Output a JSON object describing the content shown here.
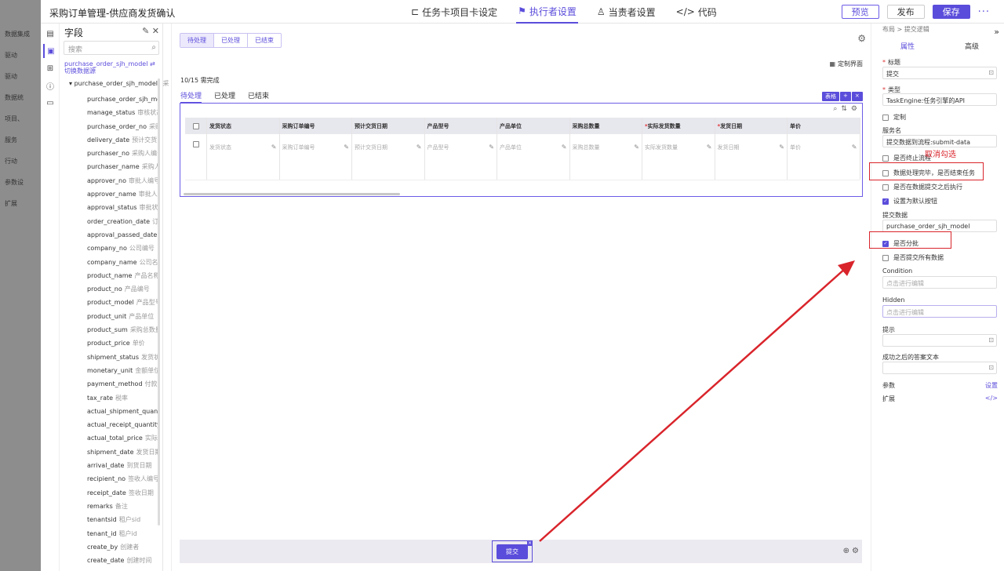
{
  "background": {
    "items": [
      "数据集成",
      "驱动",
      "驱动",
      "数据统",
      "项目、",
      "服务",
      "行动",
      "参数设",
      "扩展"
    ]
  },
  "header": {
    "title": "采购订单管理-供应商发货确认",
    "tabs": [
      {
        "label": "任务卡项目卡设定",
        "icon": "link-icon"
      },
      {
        "label": "执行者设置",
        "icon": "runner-icon"
      },
      {
        "label": "当责者设置",
        "icon": "person-icon"
      },
      {
        "label": "代码",
        "icon": "code-icon"
      }
    ],
    "preview_label": "预览",
    "publish_label": "发布",
    "save_label": "保存"
  },
  "fields_panel": {
    "title": "字段",
    "search_placeholder": "搜索",
    "datasource": "purchase_order_sjh_model",
    "switch_label": "切换数据源",
    "root": "purchase_order_sjh_model",
    "root_suffix": "采",
    "items": [
      {
        "name": "purchase_order_sjh_model",
        "cn": ""
      },
      {
        "name": "manage_status",
        "cn": "审核状态"
      },
      {
        "name": "purchase_order_no",
        "cn": "采购订"
      },
      {
        "name": "delivery_date",
        "cn": "预计交货日"
      },
      {
        "name": "purchaser_no",
        "cn": "采购人编号"
      },
      {
        "name": "purchaser_name",
        "cn": "采购人名"
      },
      {
        "name": "approver_no",
        "cn": "审批人编号"
      },
      {
        "name": "approver_name",
        "cn": "审批人名"
      },
      {
        "name": "approval_status",
        "cn": "审批状态"
      },
      {
        "name": "order_creation_date",
        "cn": "订单"
      },
      {
        "name": "approval_passed_date",
        "cn": "审"
      },
      {
        "name": "company_no",
        "cn": "公司编号"
      },
      {
        "name": "company_name",
        "cn": "公司名称"
      },
      {
        "name": "product_name",
        "cn": "产品名称"
      },
      {
        "name": "product_no",
        "cn": "产品编号"
      },
      {
        "name": "product_model",
        "cn": "产品型号"
      },
      {
        "name": "product_unit",
        "cn": "产品单位"
      },
      {
        "name": "product_sum",
        "cn": "采购总数量"
      },
      {
        "name": "product_price",
        "cn": "单价"
      },
      {
        "name": "shipment_status",
        "cn": "发货状态"
      },
      {
        "name": "monetary_unit",
        "cn": "金额单位"
      },
      {
        "name": "payment_method",
        "cn": "付款方"
      },
      {
        "name": "tax_rate",
        "cn": "税率"
      },
      {
        "name": "actual_shipment_quantity",
        "cn": ""
      },
      {
        "name": "actual_receipt_quantity",
        "cn": "实"
      },
      {
        "name": "actual_total_price",
        "cn": "实际总"
      },
      {
        "name": "shipment_date",
        "cn": "发货日期"
      },
      {
        "name": "arrival_date",
        "cn": "到货日期"
      },
      {
        "name": "recipient_no",
        "cn": "签收人编号"
      },
      {
        "name": "receipt_date",
        "cn": "签收日期"
      },
      {
        "name": "remarks",
        "cn": "备注"
      },
      {
        "name": "tenantsid",
        "cn": "租户sid"
      },
      {
        "name": "tenant_id",
        "cn": "租户id"
      },
      {
        "name": "create_by",
        "cn": "创建者"
      },
      {
        "name": "create_date",
        "cn": "创建时间"
      }
    ]
  },
  "canvas": {
    "segments": [
      "待处理",
      "已处理",
      "已结束"
    ],
    "customize_label": "定制界面",
    "progress": "10/15 需完成",
    "tabs": [
      "待处理",
      "已处理",
      "已结束"
    ],
    "table_badge": "表格",
    "columns": [
      {
        "label": "发货状态",
        "required": false,
        "placeholder": "发货状态"
      },
      {
        "label": "采购订单编号",
        "required": false,
        "placeholder": "采购订单编号"
      },
      {
        "label": "预计交货日期",
        "required": false,
        "placeholder": "预计交货日期"
      },
      {
        "label": "产品型号",
        "required": false,
        "placeholder": "产品型号"
      },
      {
        "label": "产品单位",
        "required": false,
        "placeholder": "产品单位"
      },
      {
        "label": "采购总数量",
        "required": false,
        "placeholder": "采购总数量"
      },
      {
        "label": "实际发货数量",
        "required": true,
        "placeholder": "实际发货数量"
      },
      {
        "label": "发货日期",
        "required": true,
        "placeholder": "发货日期"
      },
      {
        "label": "单价",
        "required": false,
        "placeholder": "单价"
      }
    ],
    "submit_label": "提交"
  },
  "props": {
    "breadcrumb": "布局 > 提交逻辑",
    "tabs": [
      "属性",
      "高级"
    ],
    "title_label": "标题",
    "title_value": "提交",
    "type_label": "类型",
    "type_value": "TaskEngine:任务引擎的API",
    "custom_label": "定制",
    "service_label": "服务名",
    "service_value": "提交数据到流程:submit-data",
    "terminate_label": "是否终止流程",
    "finish_label": "数据处理完毕，是否结束任务",
    "after_label": "是否在数据提交之后执行",
    "default_label": "设置为默认按钮",
    "submit_data_label": "提交数据",
    "submit_data_value": "purchase_order_sjh_model",
    "batch_label": "是否分批",
    "all_label": "是否提交所有数据",
    "condition_label": "Condition",
    "condition_placeholder": "点击进行编辑",
    "hidden_label": "Hidden",
    "hidden_placeholder": "点击进行编辑",
    "tip_label": "提示",
    "success_label": "成功之后的答案文本",
    "params_label": "参数",
    "params_link": "设置",
    "ext_label": "扩展",
    "ext_link": "</>"
  },
  "annotation": {
    "text": "取消勾选",
    "color": "#d9242b"
  },
  "accent_color": "#5b4ddb"
}
